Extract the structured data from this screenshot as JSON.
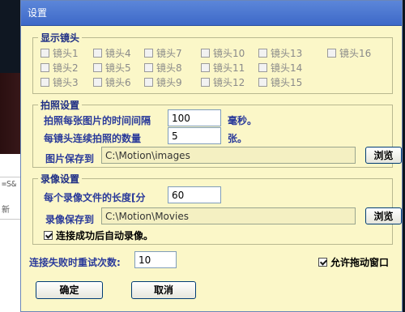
{
  "window": {
    "title": "设置"
  },
  "background": {
    "snippet": "=S&",
    "snippet2": "新"
  },
  "display_cameras": {
    "title": "显示镜头",
    "cameras": [
      {
        "label": "镜头1"
      },
      {
        "label": "镜头4"
      },
      {
        "label": "镜头7"
      },
      {
        "label": "镜头10"
      },
      {
        "label": "镜头13"
      },
      {
        "label": "镜头16"
      },
      {
        "label": "镜头2"
      },
      {
        "label": "镜头5"
      },
      {
        "label": "镜头8"
      },
      {
        "label": "镜头11"
      },
      {
        "label": "镜头14"
      },
      {
        "label": "镜头3"
      },
      {
        "label": "镜头6"
      },
      {
        "label": "镜头9"
      },
      {
        "label": "镜头12"
      },
      {
        "label": "镜头15"
      }
    ]
  },
  "photo": {
    "title": "拍照设置",
    "interval_label": "拍照每张图片的时间间隔",
    "interval_value": "100",
    "interval_unit": "毫秒。",
    "count_label": "每镜头连续拍照的数量",
    "count_value": "5",
    "count_unit": "张。",
    "save_label": "图片保存到",
    "save_path": "C:\\Motion\\images",
    "browse_label": "浏览"
  },
  "video": {
    "title": "录像设置",
    "length_label": "每个录像文件的长度[分",
    "length_value": "60",
    "save_label": "录像保存到",
    "save_path": "C:\\Motion\\Movies",
    "browse_label": "浏览",
    "auto_record_label": "连接成功后自动录像。",
    "auto_record_checked": true
  },
  "retry": {
    "label": "连接失败时重试次数:",
    "value": "10"
  },
  "allow_drag": {
    "label": "允许拖动窗口",
    "checked": true
  },
  "buttons": {
    "ok": "确定",
    "cancel": "取消"
  }
}
